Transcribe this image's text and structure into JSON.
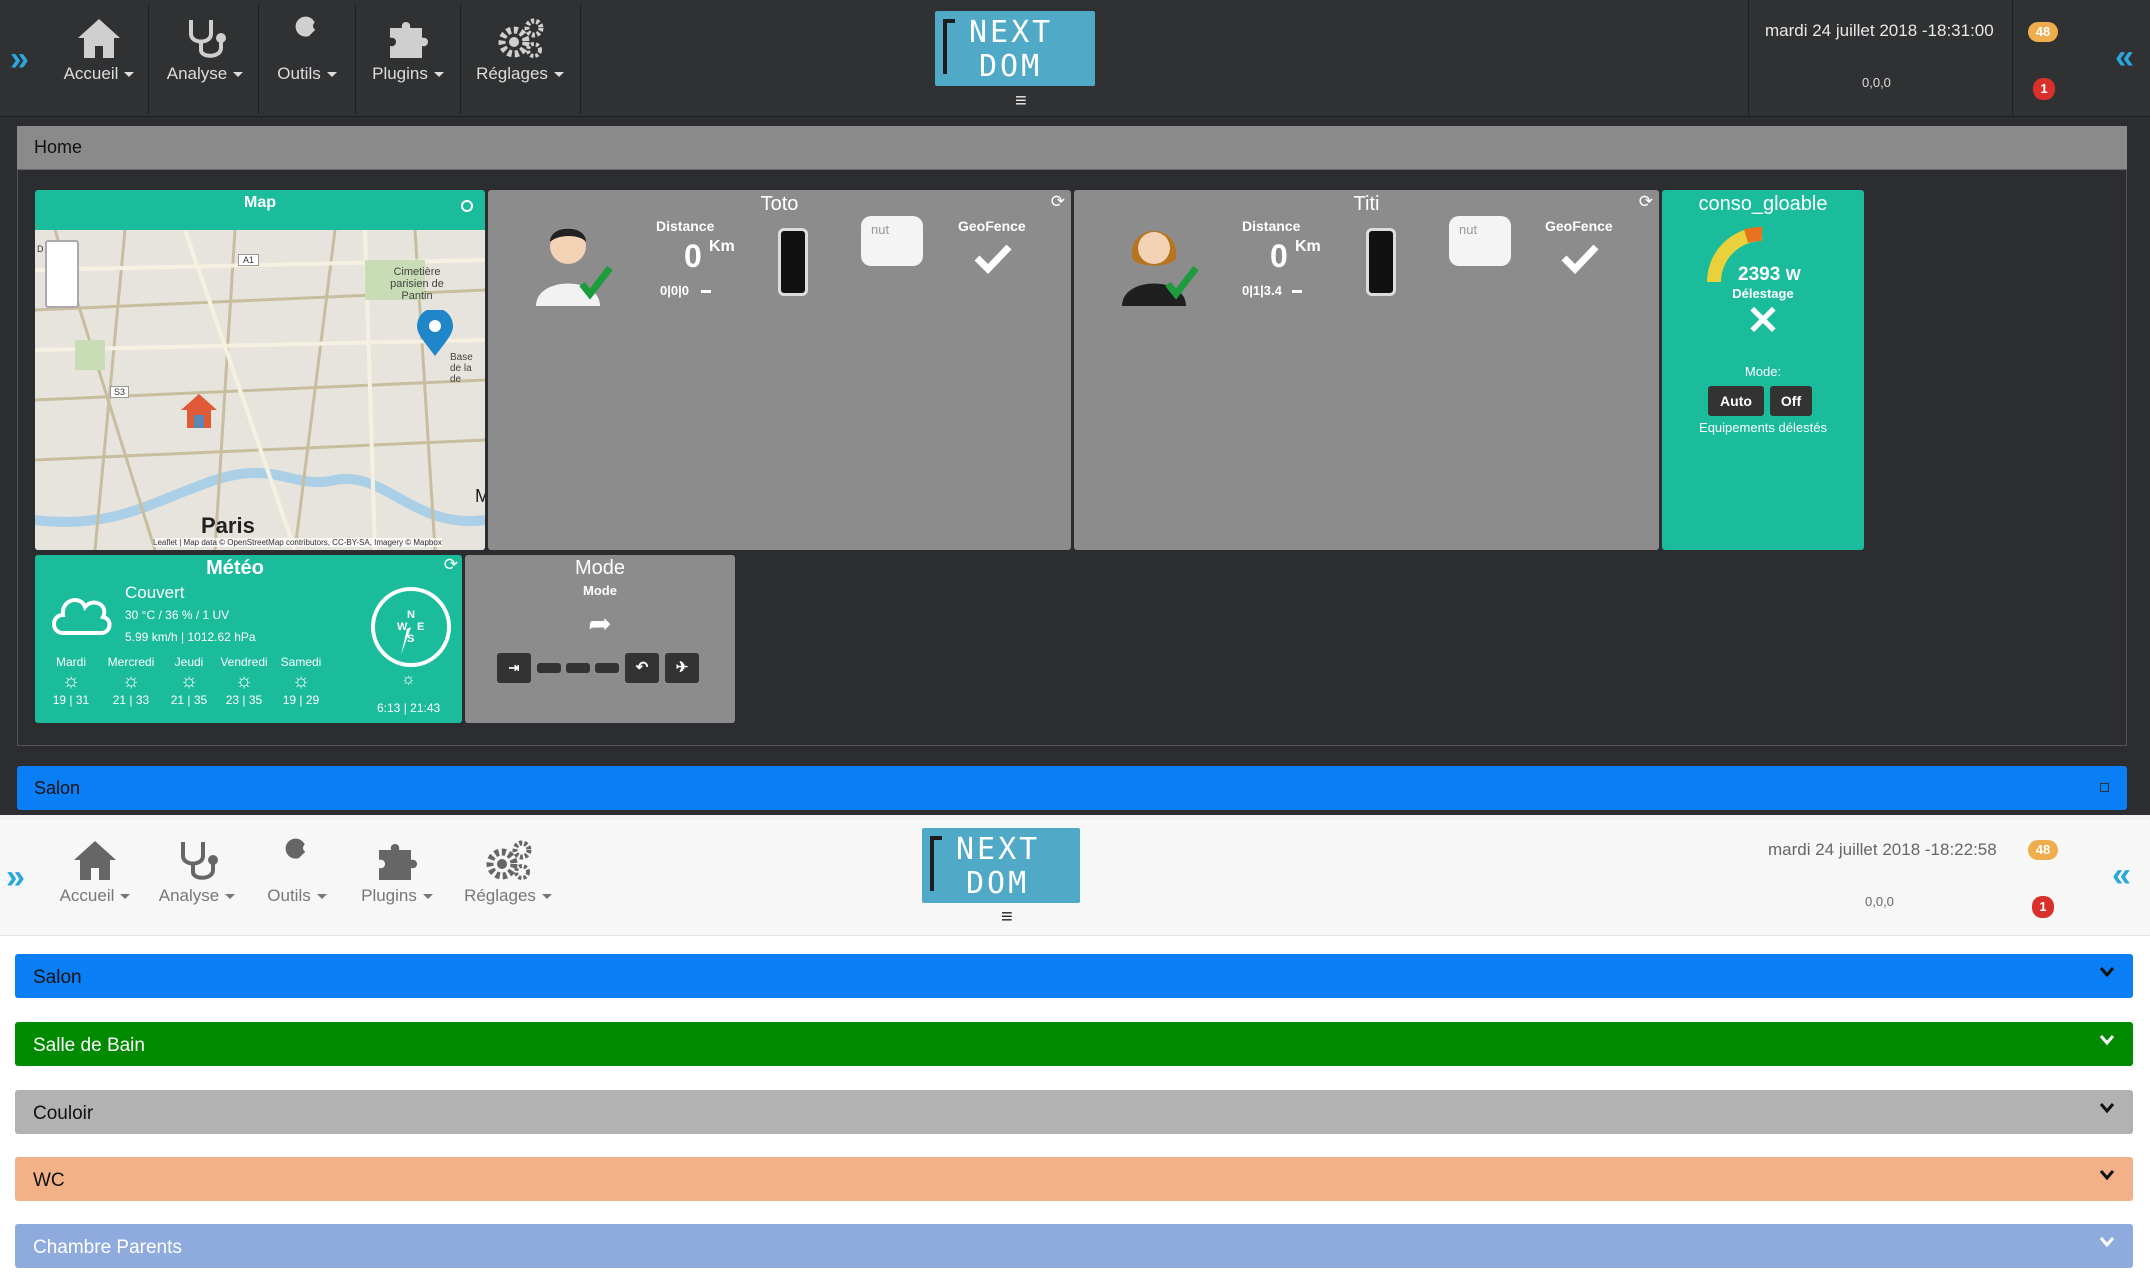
{
  "top": {
    "nav": [
      {
        "label": "Accueil",
        "icon": "home-icon"
      },
      {
        "label": "Analyse",
        "icon": "stethoscope-icon"
      },
      {
        "label": "Outils",
        "icon": "wrench-icon"
      },
      {
        "label": "Plugins",
        "icon": "puzzle-icon"
      },
      {
        "label": "Réglages",
        "icon": "gears-icon"
      }
    ],
    "logo": {
      "line1": "NEXT",
      "line2": "DOM"
    },
    "datetime": "mardi 24 juillet 2018 -18:31:00",
    "version": "0,0,0",
    "badge_messages": "48",
    "badge_alerts": "1"
  },
  "home": {
    "title": "Home",
    "map": {
      "title": "Map",
      "place1": "Cimetière parisien de Pantin",
      "place2": "Base de la de",
      "road_a1": "A1",
      "road_s3": "S3",
      "city": "Paris",
      "attribution": "Leaflet | Map data © OpenStreetMap contributors, CC-BY-SA, Imagery © Mapbox",
      "edge_letter_d": "D",
      "edge_letter_m": "M"
    },
    "persons": [
      {
        "name": "Toto",
        "distance_label": "Distance",
        "distance_value": "0",
        "distance_unit": "Km",
        "coords": "0|0|0",
        "geofence_label": "GeoFence",
        "tag_label": "nut"
      },
      {
        "name": "Titi",
        "distance_label": "Distance",
        "distance_value": "0",
        "distance_unit": "Km",
        "coords": "0|1|3.4",
        "geofence_label": "GeoFence",
        "tag_label": "nut"
      }
    ],
    "conso": {
      "title": "conso_gloable",
      "value": "2393",
      "unit": "W",
      "delestage": "Délestage",
      "mode_label": "Mode:",
      "btn_auto": "Auto",
      "btn_off": "Off",
      "equipements": "Equipements délestés"
    },
    "meteo": {
      "title": "Météo",
      "condition": "Couvert",
      "line1": "30 °C / 36 % / 1 UV",
      "line2": "5.99 km/h | 1012.62 hPa",
      "compass": {
        "n": "N",
        "w": "W",
        "e": "E",
        "s": "S"
      },
      "sun_times": "6:13 | 21:43",
      "days": [
        {
          "name": "Mardi",
          "temps": "19 | 31"
        },
        {
          "name": "Mercredi",
          "temps": "21 | 33"
        },
        {
          "name": "Jeudi",
          "temps": "21 | 35"
        },
        {
          "name": "Vendredi",
          "temps": "23 | 35"
        },
        {
          "name": "Samedi",
          "temps": "19 | 29"
        }
      ]
    },
    "mode": {
      "title": "Mode",
      "subtitle": "Mode"
    }
  },
  "salon_bar": {
    "label": "Salon",
    "icon": "square-icon"
  },
  "bottom": {
    "datetime": "mardi 24 juillet 2018 -18:22:58",
    "version": "0,0,0",
    "badge_messages": "48",
    "badge_alerts": "1",
    "rooms": [
      {
        "label": "Salon",
        "color": "#0a7ef5"
      },
      {
        "label": "Salle de Bain",
        "color": "#008a00"
      },
      {
        "label": "Couloir",
        "color": "#b2b2b2"
      },
      {
        "label": "WC",
        "color": "#f2b186"
      },
      {
        "label": "Chambre Parents",
        "color": "#8faadc"
      }
    ]
  }
}
